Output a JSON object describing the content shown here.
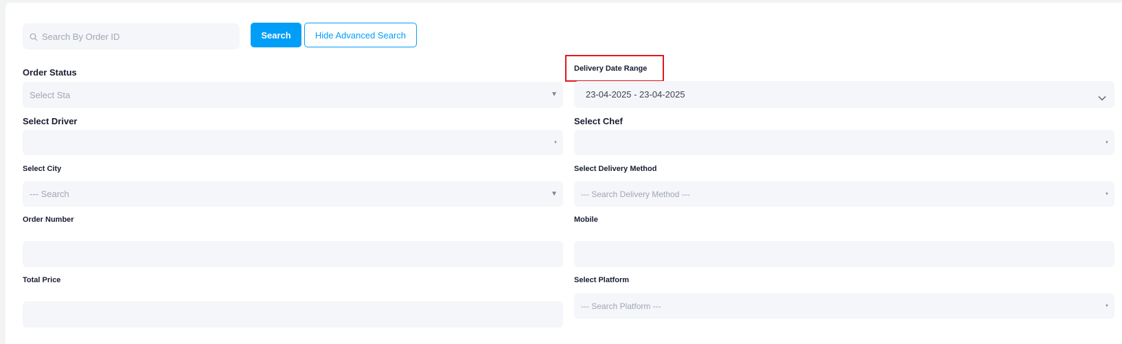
{
  "search": {
    "placeholder": "Search By Order ID",
    "search_label": "Search",
    "toggle_label": "Hide Advanced Search"
  },
  "filters": {
    "order_status": {
      "label": "Order Status",
      "placeholder": "Select Sta"
    },
    "delivery_date_range": {
      "label": "Delivery Date Range",
      "value": "23-04-2025 - 23-04-2025"
    },
    "driver": {
      "label": "Select Driver",
      "value": ""
    },
    "chef": {
      "label": "Select Chef",
      "value": ""
    },
    "city": {
      "label": "Select City",
      "placeholder": "--- Search"
    },
    "delivery_method": {
      "label": "Select Delivery Method",
      "placeholder": "--- Search Delivery Method ---"
    },
    "order_number": {
      "label": "Order Number",
      "value": ""
    },
    "mobile": {
      "label": "Mobile",
      "value": ""
    },
    "total_price": {
      "label": "Total Price",
      "value": ""
    },
    "platform": {
      "label": "Select Platform",
      "placeholder": "--- Search Platform ---"
    }
  },
  "icons": {
    "search": "search-icon",
    "caret": "caret-down-icon",
    "chevron": "chevron-down-icon"
  },
  "colors": {
    "primary": "#009ef7",
    "field_bg": "#f4f6f9",
    "highlight": "#e3141c"
  }
}
